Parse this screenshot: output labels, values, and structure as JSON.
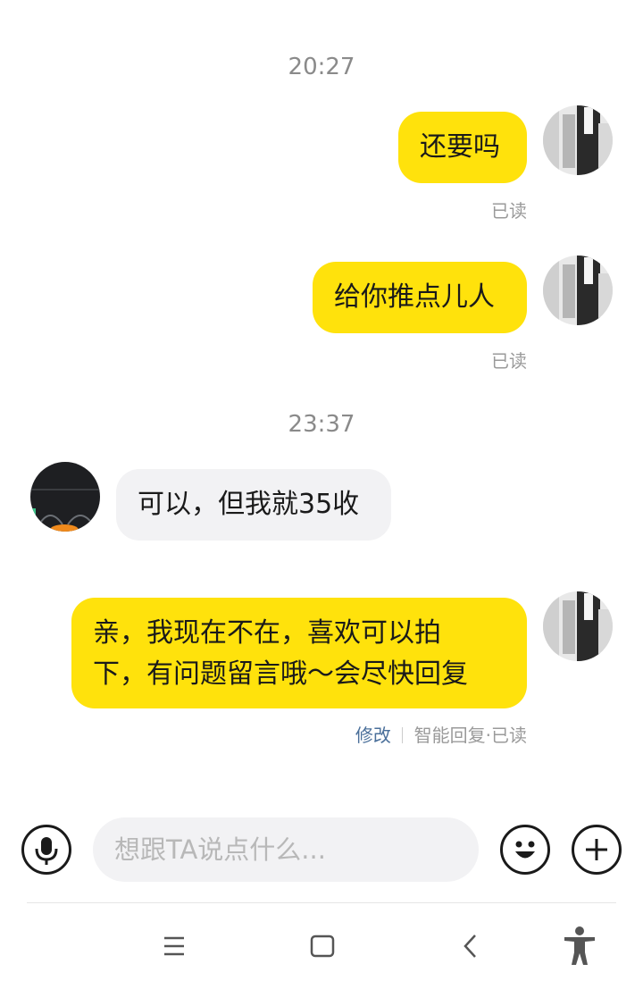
{
  "chat": {
    "time1": "20:27",
    "msg1": "还要吗",
    "read1": "已读",
    "msg2": "给你推点儿人",
    "read2": "已读",
    "time2": "23:37",
    "msg3": "可以，但我就35收",
    "msg4_line1": "亲，我现在不在，喜欢可以拍",
    "msg4_line2": "下，有问题留言哦～会尽快回复",
    "edit_link": "修改",
    "status4": "智能回复·已读"
  },
  "input_bar": {
    "placeholder": "想跟TA说点什么..."
  },
  "icons": {
    "voice": "microphone-icon",
    "emoji": "smile-icon",
    "plus": "plus-icon",
    "menu": "menu-icon",
    "home": "square-icon",
    "back": "back-icon",
    "accessibility": "accessibility-icon"
  },
  "colors": {
    "my_bubble": "#ffe20c",
    "their_bubble": "#f2f2f4",
    "link": "#4a6f9a"
  }
}
